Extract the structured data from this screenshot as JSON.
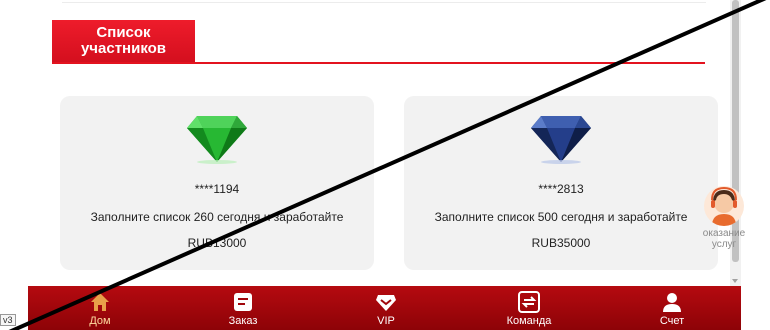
{
  "section": {
    "title_line1": "Список",
    "title_line2": "участников"
  },
  "members": [
    {
      "user": "****1194",
      "task": "Заполните список 260 сегодня и заработайте",
      "reward": "RUB13000",
      "gem": "emerald-diamond"
    },
    {
      "user": "****2813",
      "task": "Заполните список 500 сегодня и заработайте",
      "reward": "RUB35000",
      "gem": "sapphire-diamond"
    }
  ],
  "support": {
    "label_line1": "оказание",
    "label_line2": "услуг"
  },
  "nav": {
    "items": [
      {
        "label": "Дом",
        "icon": "home-icon",
        "active": true
      },
      {
        "label": "Заказ",
        "icon": "order-icon"
      },
      {
        "label": "VIP",
        "icon": "vip-icon"
      },
      {
        "label": "Команда",
        "icon": "team-icon"
      },
      {
        "label": "Счет",
        "icon": "account-icon"
      }
    ]
  },
  "corner_tag": "v3",
  "colors": {
    "brand_red": "#e3131f",
    "nav_bg": "#a0060b",
    "active_label": "#ffdba0",
    "card_bg": "#f2f2f2"
  }
}
